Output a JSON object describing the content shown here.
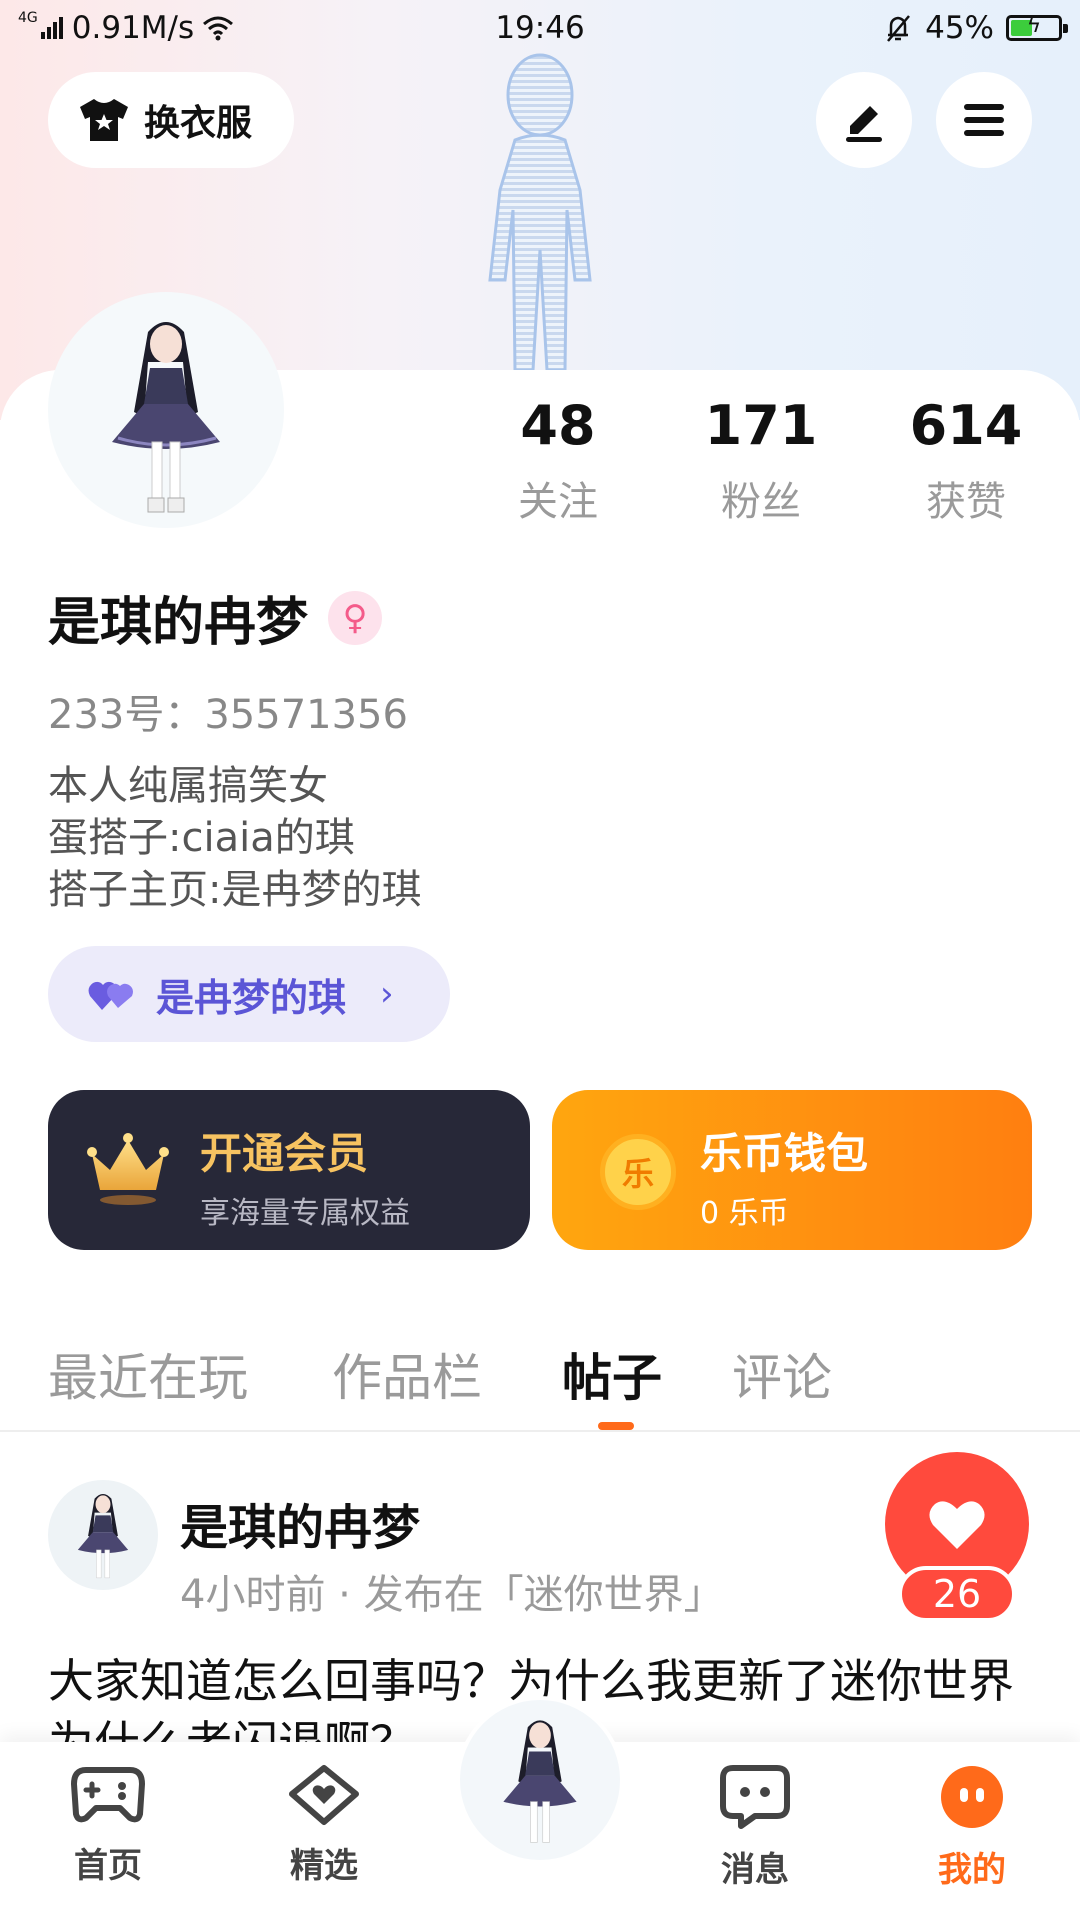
{
  "status_bar": {
    "network_type": "4G",
    "speed": "0.91M/s",
    "time": "19:46",
    "battery": "45%",
    "battery_level": 0.45
  },
  "header": {
    "change_clothes_label": "换衣服",
    "icons": [
      "shirt-icon",
      "edit-icon",
      "menu-icon"
    ]
  },
  "profile": {
    "stats": [
      {
        "value": "48",
        "label": "关注"
      },
      {
        "value": "171",
        "label": "粉丝"
      },
      {
        "value": "614",
        "label": "获赞"
      }
    ],
    "name": "是琪的冉梦",
    "gender_symbol": "♀",
    "id_line": "233号：35571356",
    "bio": [
      "本人纯属搞笑女",
      "蛋搭子:ciaia的琪",
      "搭子主页:是冉梦的琪"
    ],
    "partner": {
      "label": "是冉梦的琪",
      "chevron": "›"
    }
  },
  "cards": {
    "vip": {
      "title": "开通会员",
      "subtitle": "享海量专属权益"
    },
    "wallet": {
      "title": "乐币钱包",
      "subtitle": "0 乐币",
      "coin_glyph": "乐"
    }
  },
  "tabs": [
    {
      "label": "最近在玩",
      "active": false
    },
    {
      "label": "作品栏",
      "active": false
    },
    {
      "label": "帖子",
      "active": true
    },
    {
      "label": "评论",
      "active": false
    }
  ],
  "post": {
    "author": "是琪的冉梦",
    "meta": "4小时前 · 发布在「迷你世界」",
    "text": "大家知道怎么回事吗？为什么我更新了迷你世界为什么老闪退啊？",
    "likes": "26"
  },
  "bottom_nav": [
    {
      "label": "首页",
      "icon": "gamepad-icon"
    },
    {
      "label": "精选",
      "icon": "heart-diamond-icon"
    },
    {
      "label": "",
      "icon": "avatar-center"
    },
    {
      "label": "消息",
      "icon": "chat-icon"
    },
    {
      "label": "我的",
      "icon": "profile-face-icon",
      "active": true
    }
  ],
  "colors": {
    "accent": "#ff6a1a",
    "like": "#ff4a3d",
    "vip_bg": "#272838",
    "vip_text": "#f7c361",
    "partner_text": "#5b55d6"
  }
}
